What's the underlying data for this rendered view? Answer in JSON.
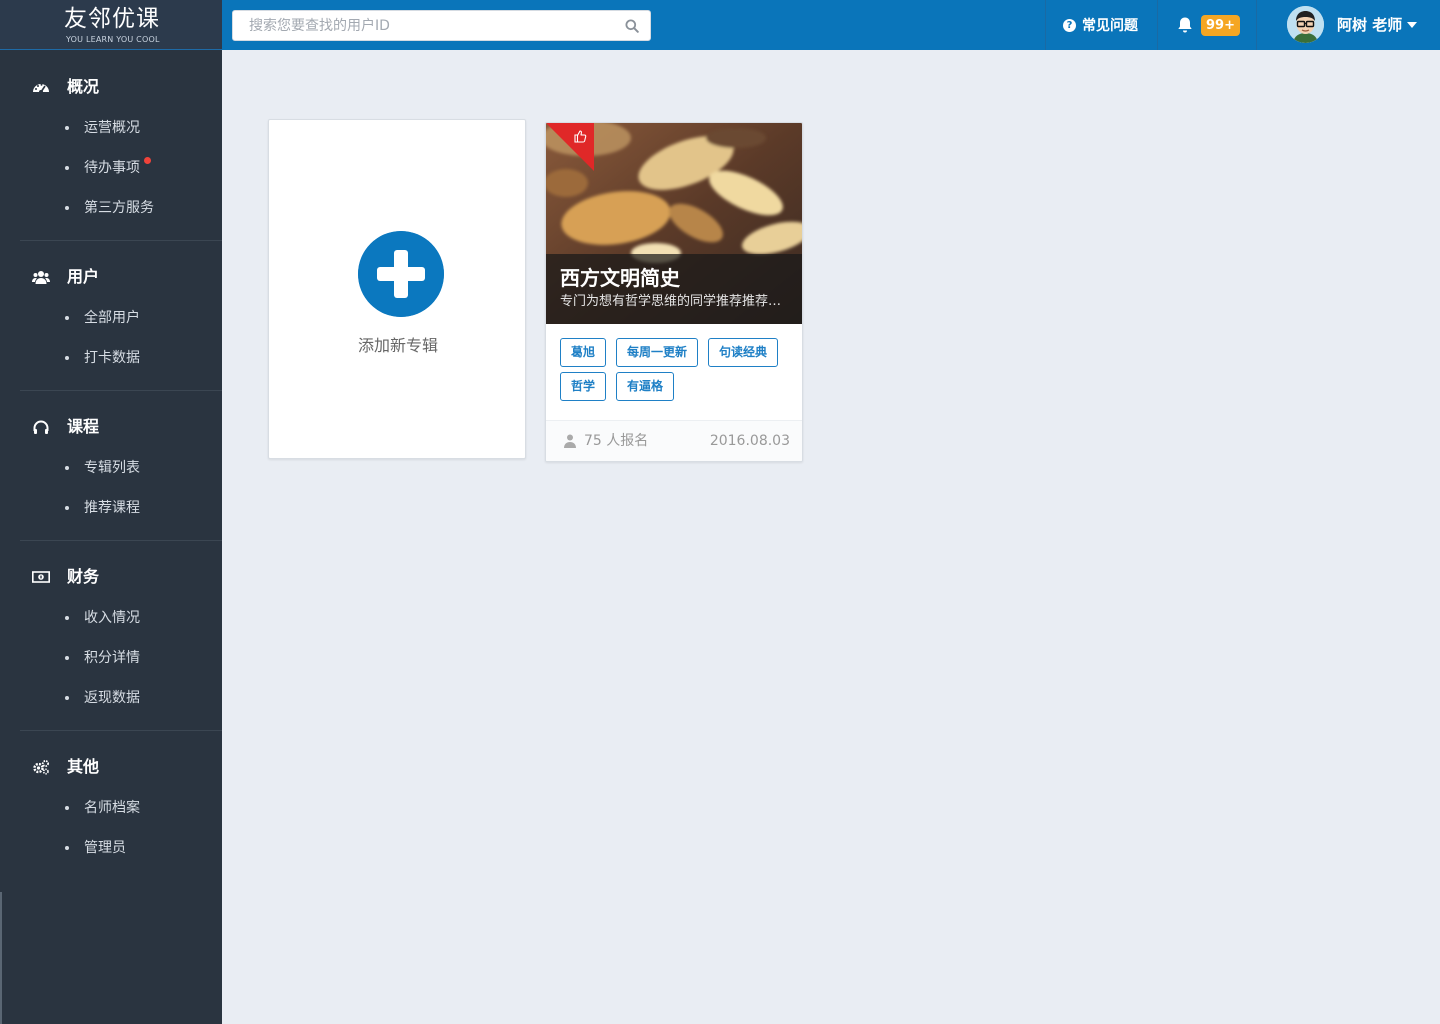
{
  "brand": {
    "name": "友邻优课",
    "tagline": "YOU LEARN YOU COOL"
  },
  "header": {
    "search_placeholder": "搜索您要查找的用户ID",
    "faq_label": "常见问题",
    "notification_count": "99+",
    "user_name": "阿树 老师",
    "accent_color": "#0a75ba",
    "badge_color": "#f5a623"
  },
  "sidebar": {
    "groups": [
      {
        "title": "概况",
        "icon": "dashboard-icon",
        "items": [
          "运营概况",
          "待办事项",
          "第三方服务"
        ]
      },
      {
        "title": "用户",
        "icon": "users-icon",
        "items": [
          "全部用户",
          "打卡数据"
        ]
      },
      {
        "title": "课程",
        "icon": "headphones-icon",
        "items": [
          "专辑列表",
          "推荐课程"
        ]
      },
      {
        "title": "财务",
        "icon": "money-icon",
        "items": [
          "收入情况",
          "积分详情",
          "返现数据"
        ]
      },
      {
        "title": "其他",
        "icon": "gears-icon",
        "items": [
          "名师档案",
          "管理员"
        ]
      }
    ]
  },
  "main": {
    "add_card_label": "添加新专辑",
    "albums": [
      {
        "title": "西方文明简史",
        "description": "专门为想有哲学思维的同学推荐推荐推荐",
        "tags": [
          "葛旭",
          "每周一更新",
          "句读经典",
          "哲学",
          "有逼格"
        ],
        "enrolled": "75 人报名",
        "date": "2016.08.03",
        "badge_icon": "thumbs-up-icon"
      }
    ]
  }
}
